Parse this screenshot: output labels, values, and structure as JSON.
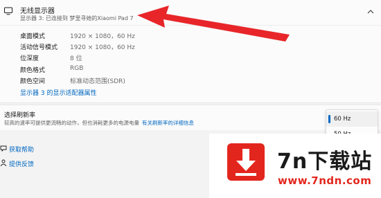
{
  "display": {
    "title": "无线显示器",
    "subtitle": "显示器 3: 已连接到 梦里寻她的Xiaomi Pad 7",
    "properties": [
      {
        "label": "桌面模式",
        "value": "1920 × 1080，60 Hz"
      },
      {
        "label": "活动信号模式",
        "value": "1920 × 1080，60 Hz"
      },
      {
        "label": "位深度",
        "value": "8 位"
      },
      {
        "label": "颜色格式",
        "value": "RGB"
      },
      {
        "label": "颜色空间",
        "value": "标准动态范围(SDR)"
      }
    ],
    "adapter_link": "显示器 3 的显示适配器属性"
  },
  "refresh": {
    "title": "选择刷新率",
    "description": "较高的速率可提供更流畅的动作，但也消耗更多的电源电量",
    "more_link": "有关刷新率的详细信息",
    "options": [
      "60 Hz",
      "50 Hz"
    ],
    "selected": "60 Hz"
  },
  "help": {
    "get_help": "获取帮助",
    "feedback": "提供反馈"
  },
  "watermark": {
    "brand": "7n下载站",
    "url": "www.7ndn.com"
  },
  "colors": {
    "accent": "#0067c0",
    "annotation_arrow": "#e8262a",
    "watermark_red": "#e3261d"
  }
}
